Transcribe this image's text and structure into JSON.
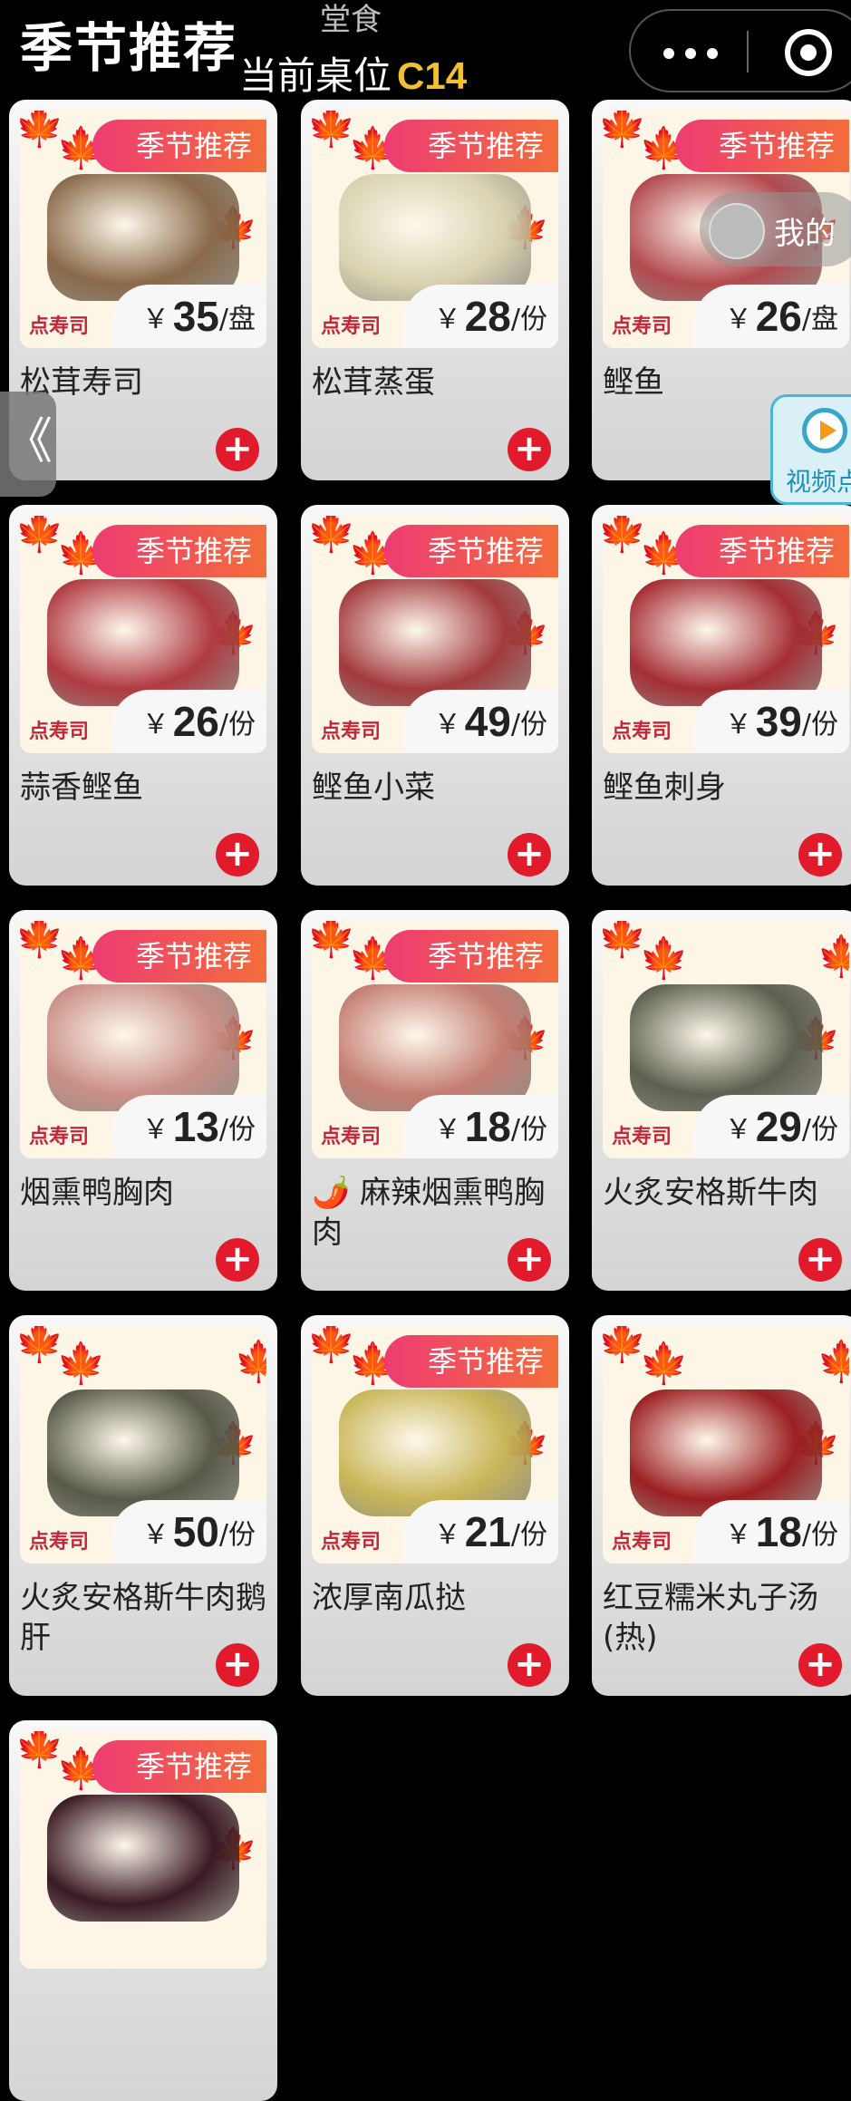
{
  "header": {
    "title": "季节推荐",
    "mode": "堂食",
    "table_prefix": "当前桌位",
    "table_code": "C14"
  },
  "capsule": {
    "more_icon": "more-dots-icon",
    "close_icon": "target-icon"
  },
  "overlays": {
    "collapse_glyph": "《",
    "mine_label": "我的",
    "video_label": "视频点"
  },
  "badge_text": "季节推荐",
  "currency": "￥",
  "add_glyph": "+",
  "items": [
    {
      "name": "松茸寿司",
      "price": "35",
      "unit": "/盘",
      "badge": true,
      "color": "#8a6a4a"
    },
    {
      "name": "松茸蒸蛋",
      "price": "28",
      "unit": "/份",
      "badge": true,
      "color": "#d8d2b0"
    },
    {
      "name": "鲣鱼",
      "price": "26",
      "unit": "/盘",
      "badge": true,
      "color": "#b24a4f"
    },
    {
      "name": "蒜香鲣鱼",
      "price": "26",
      "unit": "/份",
      "badge": true,
      "color": "#b03a42"
    },
    {
      "name": "鲣鱼小菜",
      "price": "49",
      "unit": "/份",
      "badge": true,
      "color": "#a33a3e"
    },
    {
      "name": "鲣鱼刺身",
      "price": "39",
      "unit": "/份",
      "badge": true,
      "color": "#a52d35"
    },
    {
      "name": "烟熏鸭胸肉",
      "price": "13",
      "unit": "/份",
      "badge": true,
      "color": "#c98f86"
    },
    {
      "name": "🌶️ 麻辣烟熏鸭胸肉",
      "price": "18",
      "unit": "/份",
      "badge": true,
      "color": "#c47d72"
    },
    {
      "name": "火炙安格斯牛肉",
      "price": "29",
      "unit": "/份",
      "badge": false,
      "color": "#5d6050"
    },
    {
      "name": "火炙安格斯牛肉鹅肝",
      "price": "50",
      "unit": "/份",
      "badge": false,
      "color": "#585a4a"
    },
    {
      "name": "浓厚南瓜挞",
      "price": "21",
      "unit": "/份",
      "badge": true,
      "color": "#c8b658"
    },
    {
      "name": "红豆糯米丸子汤(热)",
      "price": "18",
      "unit": "/份",
      "badge": false,
      "color": "#9c1f22"
    },
    {
      "name": "",
      "price": "",
      "unit": "",
      "badge": true,
      "color": "#3a1a24"
    }
  ]
}
